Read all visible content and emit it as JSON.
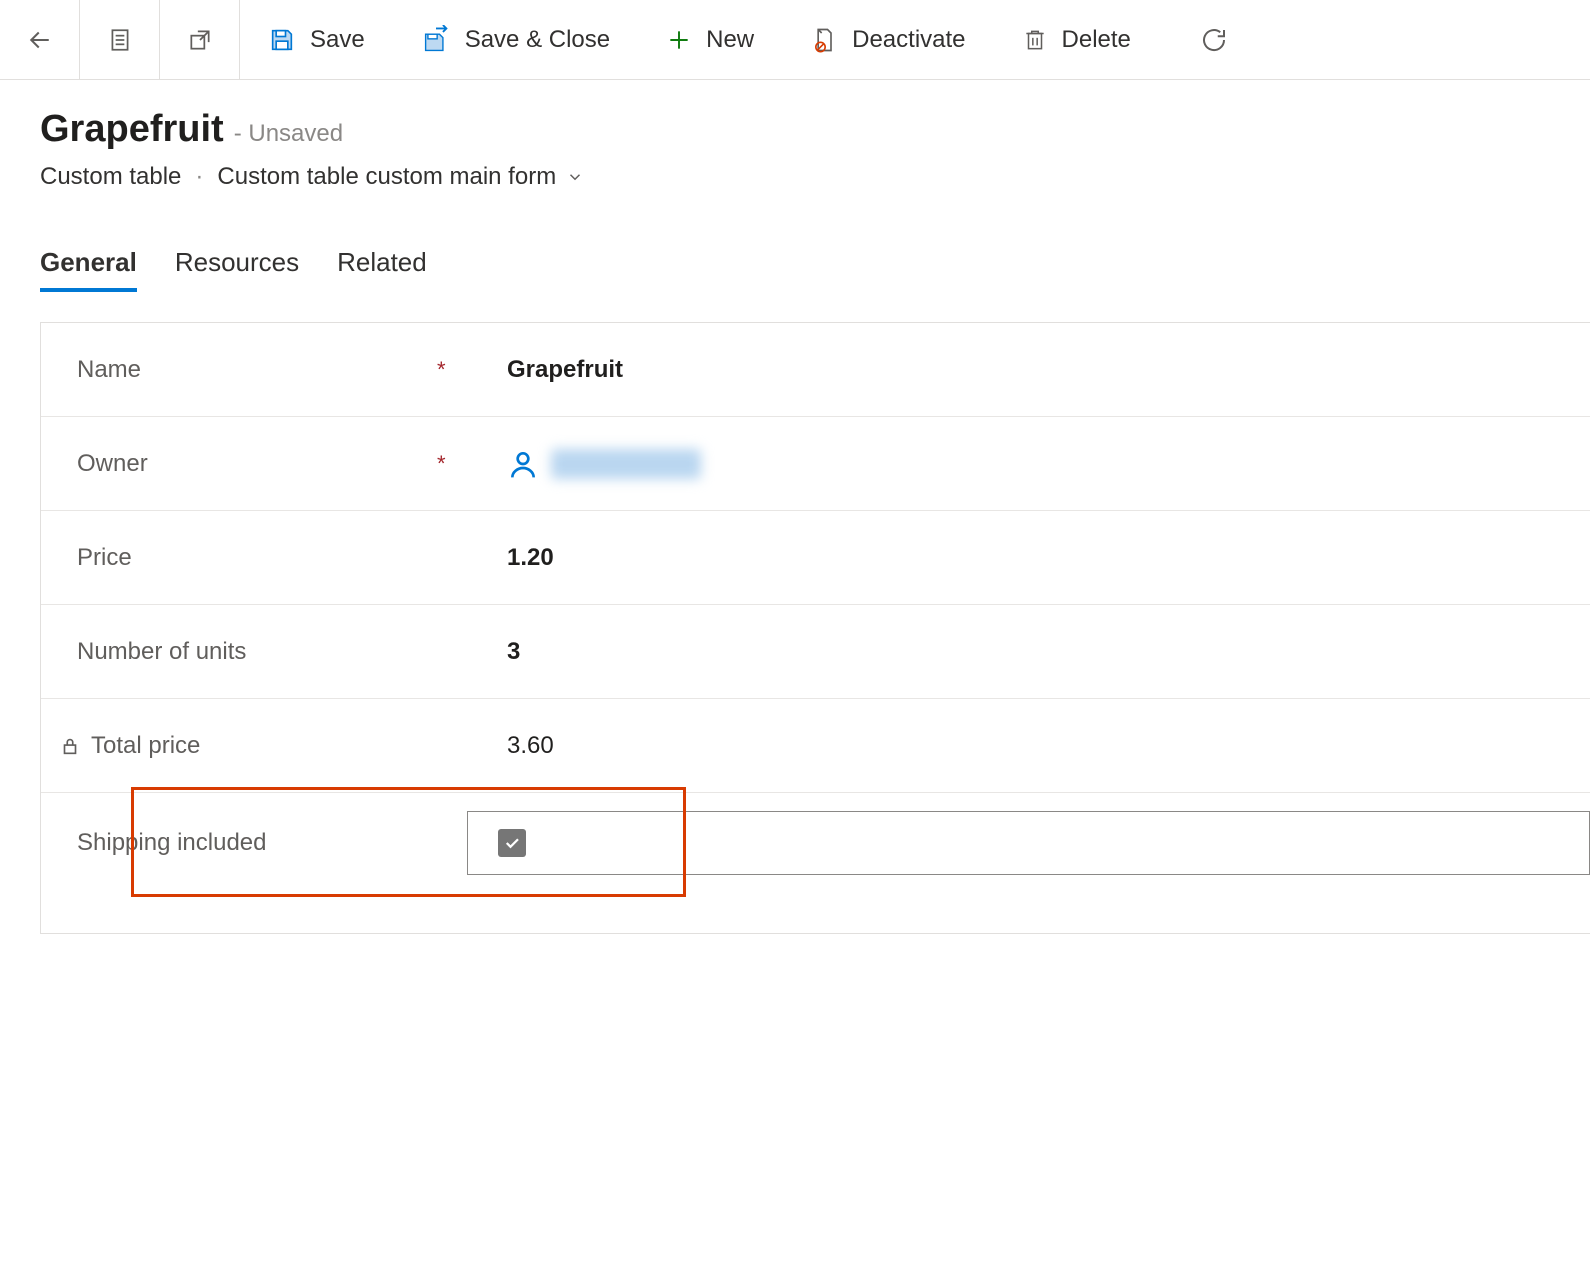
{
  "toolbar": {
    "save_label": "Save",
    "save_close_label": "Save & Close",
    "new_label": "New",
    "deactivate_label": "Deactivate",
    "delete_label": "Delete"
  },
  "header": {
    "title": "Grapefruit",
    "status_suffix": "- Unsaved",
    "entity": "Custom table",
    "form_name": "Custom table custom main form"
  },
  "tabs": {
    "general": "General",
    "resources": "Resources",
    "related": "Related"
  },
  "fields": {
    "name": {
      "label": "Name",
      "value": "Grapefruit"
    },
    "owner": {
      "label": "Owner"
    },
    "price": {
      "label": "Price",
      "value": "1.20"
    },
    "units": {
      "label": "Number of units",
      "value": "3"
    },
    "total_price": {
      "label": "Total price",
      "value": "3.60"
    },
    "shipping": {
      "label": "Shipping included",
      "checked": true
    }
  }
}
